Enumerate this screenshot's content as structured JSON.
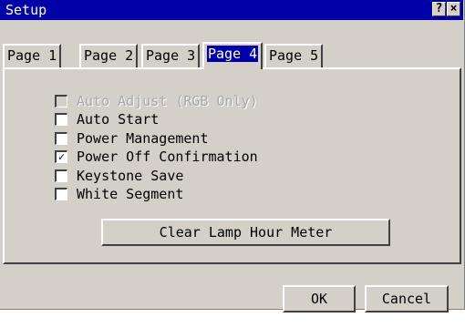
{
  "window": {
    "title": "Setup",
    "help_glyph": "?",
    "close_glyph": "×"
  },
  "tabs": [
    {
      "label": "Page 1",
      "active": false
    },
    {
      "label": "Page 2",
      "active": false
    },
    {
      "label": "Page 3",
      "active": false
    },
    {
      "label": "Page 4",
      "active": true
    },
    {
      "label": "Page 5",
      "active": false
    }
  ],
  "options": [
    {
      "label": "Auto Adjust (RGB Only)",
      "checked": false,
      "enabled": false
    },
    {
      "label": "Auto Start",
      "checked": false,
      "enabled": true
    },
    {
      "label": "Power Management",
      "checked": false,
      "enabled": true
    },
    {
      "label": "Power Off Confirmation",
      "checked": true,
      "enabled": true
    },
    {
      "label": "Keystone Save",
      "checked": false,
      "enabled": true
    },
    {
      "label": "White Segment",
      "checked": false,
      "enabled": true
    }
  ],
  "clear_lamp_button": "Clear Lamp Hour Meter",
  "ok_button": "OK",
  "cancel_button": "Cancel",
  "colors": {
    "titlebar": "#0000a8",
    "face": "#d4d0c8",
    "selected_tab": "#0000a8"
  }
}
